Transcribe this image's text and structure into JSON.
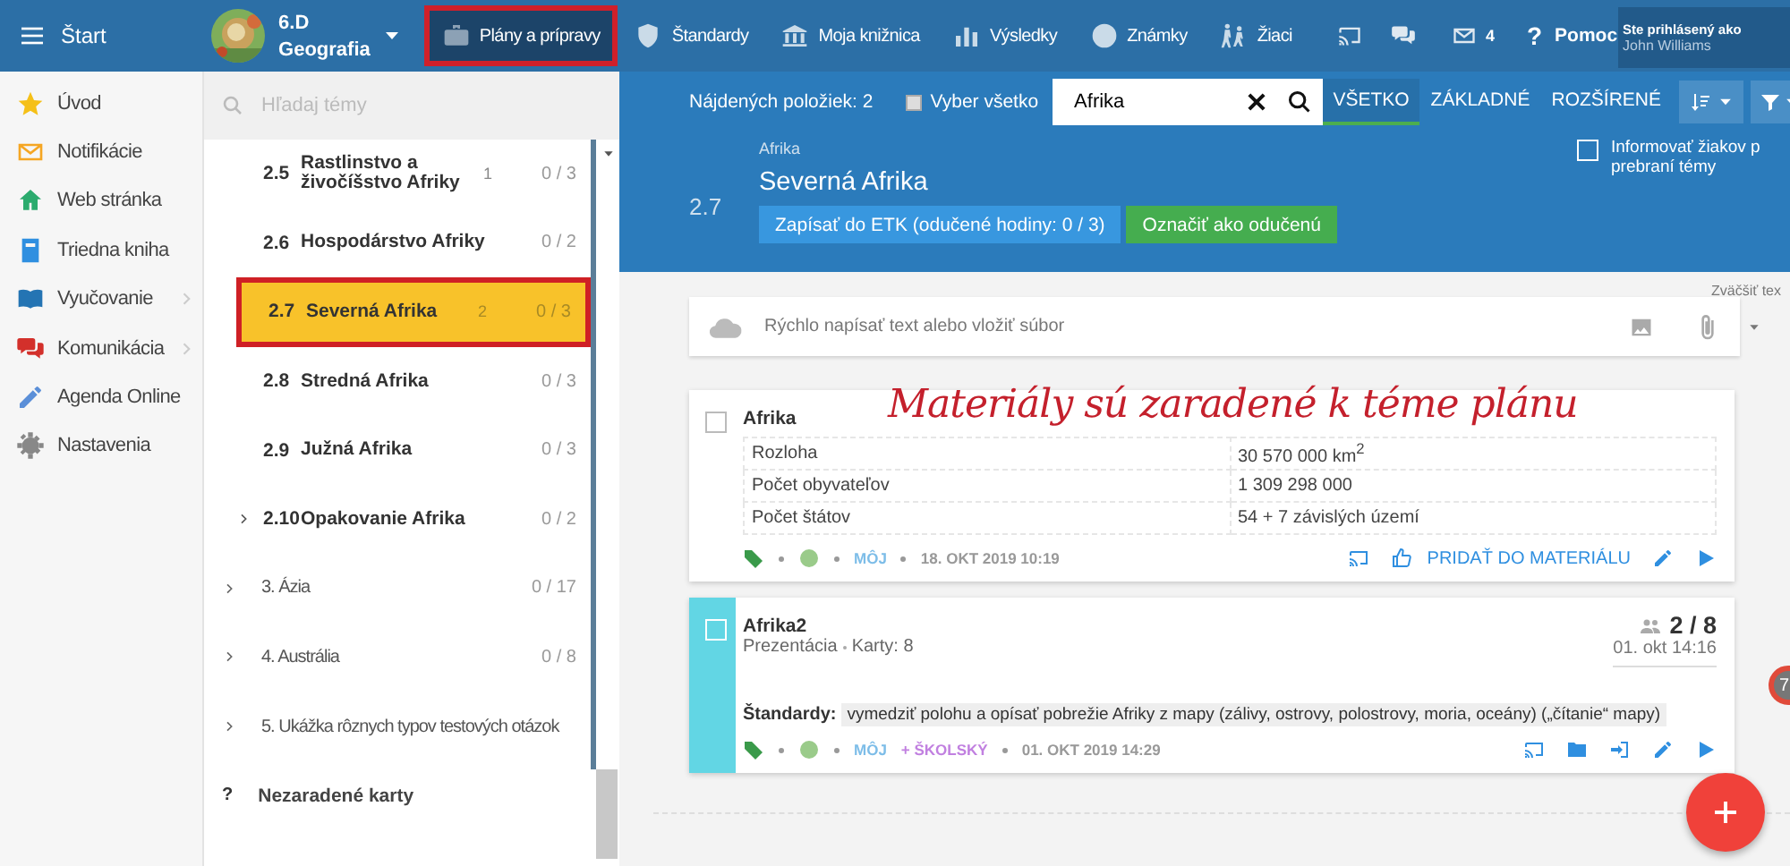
{
  "topbar": {
    "home": "Štart",
    "class_name": "6.D",
    "class_subject": "Geografia",
    "nav": [
      {
        "label": "Plány a prípravy",
        "selected": true
      },
      {
        "label": "Štandardy",
        "selected": false
      },
      {
        "label": "Moja knižnica",
        "selected": false
      },
      {
        "label": "Výsledky",
        "selected": false
      },
      {
        "label": "Známky",
        "selected": false
      },
      {
        "label": "Žiaci",
        "selected": false
      }
    ],
    "mail_count": "4",
    "help": "?",
    "help_label": "Pomoc",
    "login_label": "Ste prihlásený ako",
    "login_user": "John Williams"
  },
  "sidebar": {
    "items": [
      {
        "label": "Úvod",
        "submenu": false
      },
      {
        "label": "Notifikácie",
        "submenu": false
      },
      {
        "label": "Web stránka",
        "submenu": false
      },
      {
        "label": "Triedna kniha",
        "submenu": false
      },
      {
        "label": "Vyučovanie",
        "submenu": true
      },
      {
        "label": "Komunikácia",
        "submenu": true
      },
      {
        "label": "Agenda Online",
        "submenu": false
      },
      {
        "label": "Nastavenia",
        "submenu": false
      }
    ]
  },
  "topics": {
    "search_placeholder": "Hľadaj témy",
    "subtopics": [
      {
        "number": "2.5",
        "title": "Rastlinstvo a živočíšstvo Afriky",
        "count": "1",
        "progress": "0 / 3",
        "selected": false,
        "expandable": false
      },
      {
        "number": "2.6",
        "title": "Hospodárstvo Afriky",
        "progress": "0 / 2",
        "selected": false,
        "expandable": false
      },
      {
        "number": "2.7",
        "title": "Severná Afrika",
        "count": "2",
        "progress": "0 / 3",
        "selected": true,
        "expandable": false
      },
      {
        "number": "2.8",
        "title": "Stredná Afrika",
        "progress": "0 / 3",
        "selected": false,
        "expandable": false
      },
      {
        "number": "2.9",
        "title": "Južná Afrika",
        "progress": "0 / 3",
        "selected": false,
        "expandable": false
      },
      {
        "number": "2.10",
        "title": "Opakovanie Afrika",
        "progress": "0 / 2",
        "selected": false,
        "expandable": true
      }
    ],
    "chapters": [
      {
        "title": "3. Ázia",
        "progress": "0 / 17",
        "selected": false
      },
      {
        "title": "4. Austrália",
        "progress": "0 / 8",
        "selected": false
      },
      {
        "title": "5. Ukážka rôznych typov testových otázok",
        "selected": false
      }
    ],
    "unassigned_mark": "?",
    "unassigned": "Nezaradené karty"
  },
  "toolbar": {
    "found": "Nájdených položiek: 2",
    "select_all": "Vyber všetko",
    "select_all_checked": false,
    "search_value": "Afrika",
    "tabs": [
      {
        "label": "VŠETKO",
        "selected": true
      },
      {
        "label": "ZÁKLADNÉ",
        "selected": false
      },
      {
        "label": "ROZŠÍRENÉ",
        "selected": false
      }
    ]
  },
  "topic_header": {
    "parent": "Afrika",
    "number": "2.7",
    "title": "Severná Afrika",
    "etk_button": "Zapísať do ETK (odučené hodiny: 0 / 3)",
    "taught_button": "Označiť ako odučenú",
    "notify_label": "Informovať žiakov p",
    "notify_label_2": "prebraní témy",
    "notify_checked": false
  },
  "quick_input": {
    "placeholder": "Rýchlo napísať text alebo vložiť súbor",
    "zoom_hint": "Zväčšiť tex"
  },
  "annotation": "Materiály sú zaradené k téme plánu",
  "cards": [
    {
      "title": "Afrika",
      "checked": false,
      "table": [
        [
          "Rozloha",
          "30 570 000 km$^{2}$"
        ],
        [
          "Počet obyvateľov",
          "1 309 298 000"
        ],
        [
          "Počet štátov",
          "54 + 7 závislých území"
        ]
      ],
      "scopes": [
        {
          "label": "MÔJ",
          "kind": "own"
        }
      ],
      "date": "18. OKT 2019 10:19",
      "actions": [
        {
          "kind": "cast"
        },
        {
          "kind": "like"
        },
        {
          "kind": "link",
          "label": "PRIDAŤ DO MATERIÁLU"
        },
        {
          "kind": "edit"
        },
        {
          "kind": "play"
        }
      ]
    },
    {
      "title": "Afrika2",
      "color": "#62d6e4",
      "checked": false,
      "type": "Prezentácia",
      "cards_count": "Karty: 8",
      "score": "2 / 8",
      "score_date": "01. okt 14:16",
      "standards_label": "Štandardy:",
      "standards": "vymedziť polohu a opísať pobrežie Afriky z mapy (zálivy, ostrovy, polostrovy, moria, oceány) („čítanie“ mapy)",
      "scopes": [
        {
          "label": "MÔJ",
          "kind": "own"
        },
        {
          "label": "+ ŠKOLSKÝ",
          "kind": "school"
        }
      ],
      "date": "01. OKT 2019 14:29",
      "actions": [
        {
          "kind": "cast"
        },
        {
          "kind": "folder"
        },
        {
          "kind": "assign"
        },
        {
          "kind": "edit"
        },
        {
          "kind": "play"
        }
      ]
    }
  ],
  "side_gauge": "7"
}
